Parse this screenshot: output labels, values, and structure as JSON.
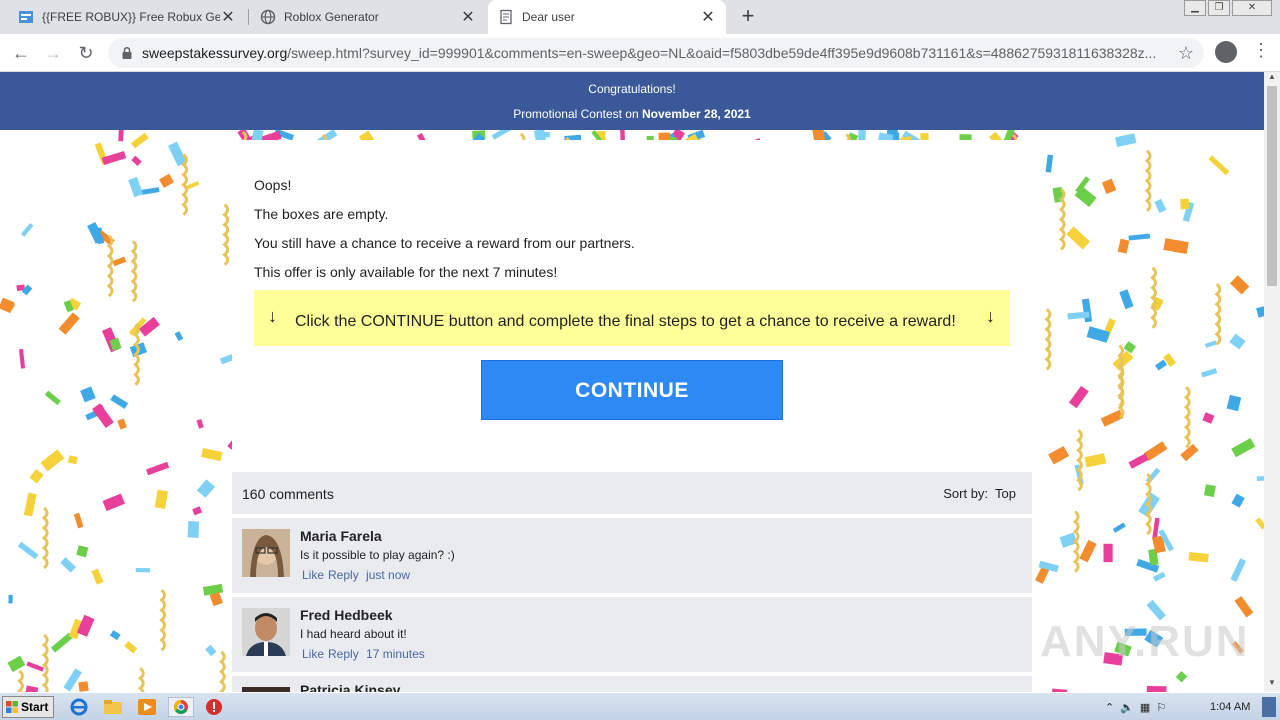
{
  "browser": {
    "tabs": [
      {
        "title": "{{FREE ROBUX}} Free Robux Genera",
        "icon": "page-icon",
        "active": false
      },
      {
        "title": "Roblox Generator",
        "icon": "globe-icon",
        "active": false
      },
      {
        "title": "Dear user",
        "icon": "document-icon",
        "active": true
      }
    ],
    "new_tab_label": "+",
    "url_domain": "sweepstakessurvey.org",
    "url_rest": "/sweep.html?survey_id=999901&comments=en-sweep&geo=NL&oaid=f5803dbe59de4ff395e9d9608b731161&s=4886275931811638328z..."
  },
  "header": {
    "line1": "Congratulations!",
    "line2_prefix": "Promotional Contest on ",
    "line2_date": "November 28, 2021"
  },
  "card": {
    "lines": [
      "Oops!",
      "The boxes are empty.",
      "You still have a chance to receive a reward from our partners.",
      "This offer is only available for the next 7 minutes!"
    ],
    "notice_arrow": "↓",
    "notice_text": "Click the CONTINUE button and complete the final steps to get a chance to receive a reward!",
    "continue_label": "CONTINUE"
  },
  "comments": {
    "count_label": "160 comments",
    "sort_label": "Sort by:",
    "sort_value": "Top",
    "items": [
      {
        "name": "Maria Farela",
        "text": "Is it possible to play again? :)",
        "like": "Like",
        "reply": "Reply",
        "time": "just now"
      },
      {
        "name": "Fred Hedbeek",
        "text": "I had heard about it!",
        "like": "Like",
        "reply": "Reply",
        "time": "17 minutes"
      },
      {
        "name": "Patricia Kinsey",
        "text": "",
        "like": "",
        "reply": "",
        "time": ""
      }
    ]
  },
  "watermark": "ANY.RUN",
  "taskbar": {
    "start_label": "Start",
    "clock": "1:04 AM"
  },
  "colors": {
    "header_bg": "#3b5998",
    "notice_bg": "#ffff99",
    "continue_bg": "#2e89f5",
    "comment_bg": "#e9ebee",
    "link": "#4b67a1"
  }
}
